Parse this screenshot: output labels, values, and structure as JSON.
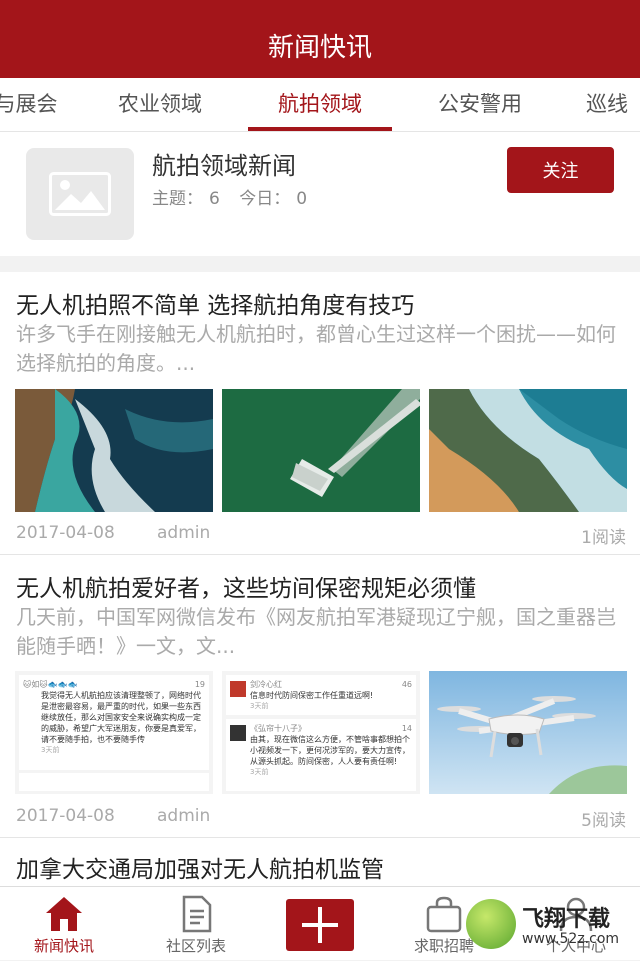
{
  "header": {
    "title": "新闻快讯"
  },
  "tabs": [
    {
      "label": "与展会"
    },
    {
      "label": "农业领域"
    },
    {
      "label": "航拍领域"
    },
    {
      "label": "公安警用"
    },
    {
      "label": "巡线"
    }
  ],
  "forum": {
    "title": "航拍领域新闻",
    "topics_label": "主题：",
    "topics": "6",
    "today_label": "今日：",
    "today": "0",
    "follow_label": "关注"
  },
  "posts": [
    {
      "title": "无人机拍照不简单 选择航拍角度有技巧",
      "excerpt": "许多飞手在刚接触无人机航拍时，都曾心生过这样一个困扰——如何选择航拍的角度。...",
      "date": "2017-04-08",
      "author": "admin",
      "reads": "1阅读"
    },
    {
      "title": "无人机航拍爱好者，这些坊间保密规矩必须懂",
      "excerpt": "几天前，中国军网微信发布《网友航拍军港疑现辽宁舰，国之重器岂能随手晒！》一文，文...",
      "date": "2017-04-08",
      "author": "admin",
      "reads": "5阅读",
      "comments": [
        {
          "user": "🐱如🐱🐟🐟🐟",
          "likes": "19",
          "text": "我觉得无人机航拍应该清理整顿了，网络时代是泄密最容易，最严重的时代，如果一些东西继续放任，那么对国家安全来说确实构成一定的威胁，希望广大军迷朋友，你要是真爱军，请不要随手拍，也不要随手传",
          "time": "3天前"
        },
        {
          "user": "剑冷心红",
          "likes": "46",
          "text": "信息时代防间保密工作任重道远啊!",
          "time": "3天前"
        },
        {
          "user": "《弘帘十八子》",
          "likes": "14",
          "text": "由其，现在微信这么方便，不管啥事都想拍个小视频发一下，更何况涉军的，要大力宣传，从源头抓起。防间保密，人人要有责任啊!",
          "time": "3天前"
        }
      ]
    },
    {
      "title": "加拿大交通局加强对无人航拍机监管"
    }
  ],
  "bottom_nav": [
    {
      "label": "新闻快讯",
      "icon": "home-icon"
    },
    {
      "label": "社区列表",
      "icon": "document-icon"
    },
    {
      "label": "",
      "icon": "plus-icon"
    },
    {
      "label": "求职招聘",
      "icon": "bag-icon"
    },
    {
      "label": "个人中心",
      "icon": "person-icon"
    }
  ],
  "watermark": {
    "name": "飞翔下载",
    "url": "www.52z.com"
  },
  "colors": {
    "accent": "#a3151a"
  }
}
